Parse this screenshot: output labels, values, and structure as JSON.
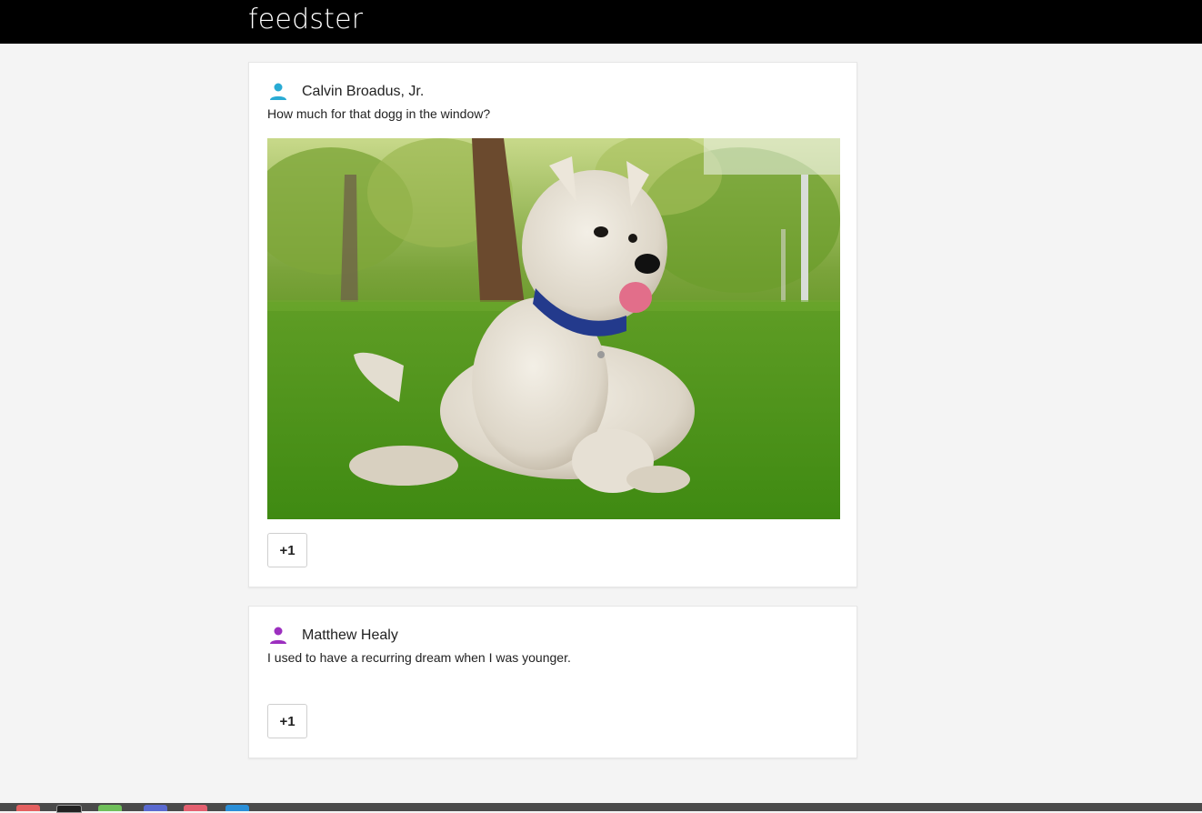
{
  "app": {
    "brand": "feedster"
  },
  "colors": {
    "topbar": "#000000",
    "background": "#f4f4f4",
    "card": "#ffffff",
    "user1_icon": "#29abd4",
    "user2_icon": "#9c2fbf"
  },
  "posts": [
    {
      "author": "Calvin Broadus, Jr.",
      "text": "How much for that dogg in the window?",
      "has_image": true,
      "image_subject": "west highland terrier sitting on grass",
      "avatar_icon": "person-icon",
      "plus_label": "+1"
    },
    {
      "author": "Matthew Healy",
      "text": "I used to have a recurring dream when I was younger.",
      "has_image": false,
      "avatar_icon": "person-icon",
      "plus_label": "+1"
    }
  ]
}
